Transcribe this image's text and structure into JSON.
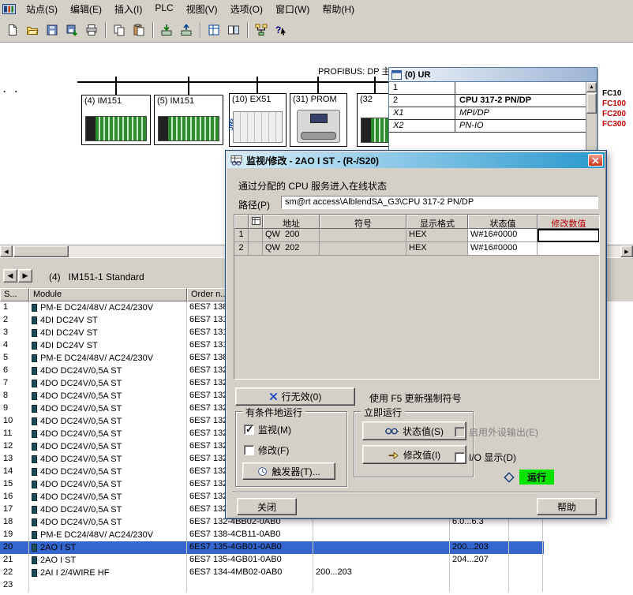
{
  "menubar": {
    "items": [
      "站点(S)",
      "编辑(E)",
      "插入(I)",
      "PLC",
      "视图(V)",
      "选项(O)",
      "窗口(W)",
      "帮助(H)"
    ]
  },
  "toolbar": {
    "icons": [
      "new-icon",
      "open-icon",
      "save-icon",
      "save-compile-icon",
      "print-icon",
      "copy-icon",
      "paste-icon",
      "download-icon",
      "upload-icon",
      "catalog-icon",
      "split-window-icon",
      "network-icon",
      "context-help-icon"
    ]
  },
  "canvas": {
    "corner_dots": ". .",
    "bus_label": "PROFIBUS: DP 主",
    "modules": [
      {
        "label": "(4) IM151",
        "kind": "im151"
      },
      {
        "label": "(5) IM151",
        "kind": "im151"
      },
      {
        "label": "(10) EX51",
        "kind": "ex51",
        "brand": "SMC"
      },
      {
        "label": "(31) PROM",
        "kind": "prom"
      },
      {
        "label": "(32",
        "kind": "im151"
      }
    ],
    "rack_window": {
      "title": "(0) UR",
      "rows": [
        {
          "slot": "1",
          "name": ""
        },
        {
          "slot": "2",
          "name": "CPU 317-2 PN/DP",
          "bold": true
        },
        {
          "slot": "X1",
          "name": "MPI/DP",
          "italic": true
        },
        {
          "slot": "X2",
          "name": "PN-IO",
          "italic": true
        }
      ]
    },
    "catalog_strip": [
      {
        "label": "FC10"
      },
      {
        "label": "FC100",
        "red": true
      },
      {
        "label": "FC200",
        "red": true
      },
      {
        "label": "FC300",
        "red": true
      }
    ]
  },
  "dialog": {
    "title": "监视/修改 - 2AO I ST - (R-/S20)",
    "intro": "通过分配的 CPU 服务进入在线状态",
    "path_label": "路径(P)",
    "path_value": "sm@rt access\\AlblendSA_G3\\CPU 317-2 PN/DP",
    "table": {
      "headers": {
        "address": "地址",
        "symbol": "符号",
        "format": "显示格式",
        "status": "状态值",
        "modify": "修改数值"
      },
      "rows": [
        {
          "num": "1",
          "address": "QW  200",
          "symbol": "",
          "format": "HEX",
          "status": "W#16#0000",
          "modify": "",
          "focus": true
        },
        {
          "num": "2",
          "address": "QW  202",
          "symbol": "",
          "format": "HEX",
          "status": "W#16#0000",
          "modify": ""
        }
      ]
    },
    "invalid_row_button": "行无效(0)",
    "f5_hint": "使用 F5 更新强制符号",
    "conditional_group": {
      "title": "有条件地运行",
      "monitor": "监视(M)",
      "monitor_checked": true,
      "modify": "修改(F)",
      "modify_checked": false,
      "trigger_button": "触发器(T)..."
    },
    "immediate_group": {
      "title": "立即运行",
      "status_button": "状态值(S)",
      "modify_button": "修改值(I)"
    },
    "enable_peripheral_outputs": "启用外设输出(E)",
    "io_display": "I/O 显示(D)",
    "run_status": "运行",
    "close_button": "关闭",
    "help_button": "帮助"
  },
  "station": {
    "label": "(4)   IM151-1 Standard",
    "table": {
      "headers": {
        "slot": "S...",
        "module": "Module",
        "order": "Order n..."
      },
      "rows": [
        {
          "num": "1",
          "module": "PM-E DC24/48V/ AC24/230V",
          "order": "6ES7 138",
          "i": "",
          "q": ""
        },
        {
          "num": "2",
          "module": "4DI DC24V ST",
          "order": "6ES7 131",
          "i": "",
          "q": ""
        },
        {
          "num": "3",
          "module": "4DI DC24V ST",
          "order": "6ES7 131",
          "i": "",
          "q": ""
        },
        {
          "num": "4",
          "module": "4DI DC24V ST",
          "order": "6ES7 131",
          "i": "",
          "q": ""
        },
        {
          "num": "5",
          "module": "PM-E DC24/48V/ AC24/230V",
          "order": "6ES7 138",
          "i": "",
          "q": ""
        },
        {
          "num": "6",
          "module": "4DO DC24V/0,5A ST",
          "order": "6ES7 132",
          "i": "",
          "q": ""
        },
        {
          "num": "7",
          "module": "4DO DC24V/0,5A ST",
          "order": "6ES7 132",
          "i": "",
          "q": ""
        },
        {
          "num": "8",
          "module": "4DO DC24V/0,5A ST",
          "order": "6ES7 132",
          "i": "",
          "q": ""
        },
        {
          "num": "9",
          "module": "4DO DC24V/0,5A ST",
          "order": "6ES7 132",
          "i": "",
          "q": ""
        },
        {
          "num": "10",
          "module": "4DO DC24V/0,5A ST",
          "order": "6ES7 132",
          "i": "",
          "q": ""
        },
        {
          "num": "11",
          "module": "4DO DC24V/0,5A ST",
          "order": "6ES7 132",
          "i": "",
          "q": ""
        },
        {
          "num": "12",
          "module": "4DO DC24V/0,5A ST",
          "order": "6ES7 132",
          "i": "",
          "q": ""
        },
        {
          "num": "13",
          "module": "4DO DC24V/0,5A ST",
          "order": "6ES7 132",
          "i": "",
          "q": ""
        },
        {
          "num": "14",
          "module": "4DO DC24V/0,5A ST",
          "order": "6ES7 132",
          "i": "",
          "q": ""
        },
        {
          "num": "15",
          "module": "4DO DC24V/0,5A ST",
          "order": "6ES7 132",
          "i": "",
          "q": ""
        },
        {
          "num": "16",
          "module": "4DO DC24V/0,5A ST",
          "order": "6ES7 132",
          "i": "",
          "q": ""
        },
        {
          "num": "17",
          "module": "4DO DC24V/0,5A ST",
          "order": "6ES7 132",
          "i": "",
          "q": ""
        },
        {
          "num": "18",
          "module": "4DO DC24V/0,5A ST",
          "order": "6ES7 132-4BB02-0AB0",
          "i": "",
          "q": "6.0...6.3"
        },
        {
          "num": "19",
          "module": "PM-E DC24/48V/ AC24/230V",
          "order": "6ES7 138-4CB11-0AB0",
          "i": "",
          "q": ""
        },
        {
          "num": "20",
          "module": "2AO I ST",
          "order": "6ES7 135-4GB01-0AB0",
          "i": "",
          "q": "200...203",
          "selected": true
        },
        {
          "num": "21",
          "module": "2AO I ST",
          "order": "6ES7 135-4GB01-0AB0",
          "i": "",
          "q": "204...207"
        },
        {
          "num": "22",
          "module": "2AI I 2/4WIRE HF",
          "order": "6ES7 134-4MB02-0AB0",
          "i": "200...203",
          "q": ""
        },
        {
          "num": "23",
          "module": "",
          "order": "",
          "i": "",
          "q": ""
        }
      ]
    }
  }
}
